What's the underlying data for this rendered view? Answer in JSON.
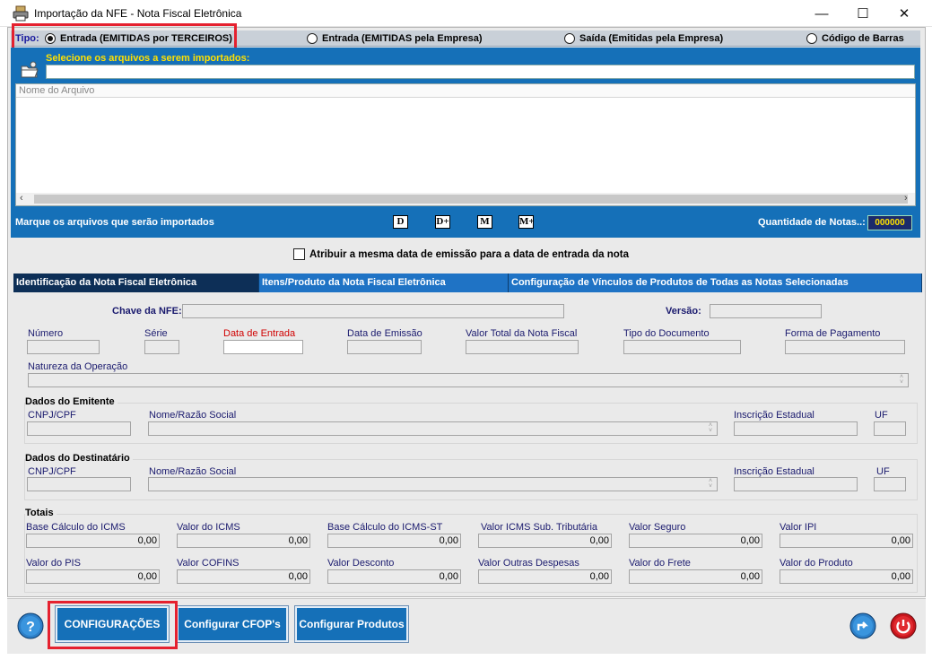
{
  "window": {
    "title": "Importação da NFE - Nota Fiscal Eletrônica",
    "minimize": "—",
    "maximize": "☐",
    "close": "✕"
  },
  "tipo": {
    "label": "Tipo:",
    "options": [
      {
        "label": "Entrada (EMITIDAS por TERCEIROS)",
        "selected": true
      },
      {
        "label": "Entrada (EMITIDAS pela Empresa)",
        "selected": false
      },
      {
        "label": "Saída (Emitidas pela Empresa)",
        "selected": false
      },
      {
        "label": "Código de Barras",
        "selected": false
      }
    ]
  },
  "files": {
    "select_label": "Selecione os arquivos a serem importados:",
    "column_header": "Nome do Arquivo",
    "mark_label": "Marque os arquivos que serão importados",
    "buttons": [
      "D",
      "D+",
      "M",
      "M+"
    ],
    "qty_label": "Quantidade de Notas..:",
    "qty_value": "000000"
  },
  "same_date_label": "Atribuir a mesma data de emissão para a data de entrada da nota",
  "tabs": [
    {
      "label": "Identificação da Nota Fiscal Eletrônica"
    },
    {
      "label": "Itens/Produto da Nota Fiscal Eletrônica"
    },
    {
      "label": "Configuração de Vínculos de Produtos de Todas as Notas Selecionadas"
    }
  ],
  "nfe": {
    "chave_label": "Chave da NFE:",
    "versao_label": "Versão:",
    "numero": "Número",
    "serie": "Série",
    "data_entrada": "Data de Entrada",
    "data_emissao": "Data de Emissão",
    "valor_total": "Valor Total da Nota Fiscal",
    "tipo_documento": "Tipo do Documento",
    "forma_pagamento": "Forma de Pagamento",
    "natureza": "Natureza da Operação"
  },
  "emitente": {
    "title": "Dados do Emitente",
    "cnpj": "CNPJ/CPF",
    "nome": "Nome/Razão Social",
    "ie": "Inscrição Estadual",
    "uf": "UF"
  },
  "destinatario": {
    "title": "Dados do Destinatário",
    "cnpj": "CNPJ/CPF",
    "nome": "Nome/Razão Social",
    "ie": "Inscrição Estadual",
    "uf": "UF"
  },
  "totais": {
    "title": "Totais",
    "row1": [
      {
        "label": "Base Cálculo do ICMS",
        "value": "0,00"
      },
      {
        "label": "Valor do ICMS",
        "value": "0,00"
      },
      {
        "label": "Base Cálculo do ICMS-ST",
        "value": "0,00"
      },
      {
        "label": "Valor ICMS Sub. Tributária",
        "value": "0,00"
      },
      {
        "label": "Valor Seguro",
        "value": "0,00"
      },
      {
        "label": "Valor IPI",
        "value": "0,00"
      }
    ],
    "row2": [
      {
        "label": "Valor do PIS",
        "value": "0,00"
      },
      {
        "label": "Valor COFINS",
        "value": "0,00"
      },
      {
        "label": "Valor Desconto",
        "value": "0,00"
      },
      {
        "label": "Valor Outras Despesas",
        "value": "0,00"
      },
      {
        "label": "Valor do Frete",
        "value": "0,00"
      },
      {
        "label": "Valor do Produto",
        "value": "0,00"
      }
    ]
  },
  "footer": {
    "configuracoes": "CONFIGURAÇÕES",
    "cfop": "Configurar CFOP's",
    "produtos": "Configurar Produtos"
  },
  "colors": {
    "panel_blue": "#1570b8",
    "tab_active": "#0d2f57",
    "highlight_red": "#e5212f",
    "label_red": "#d00000"
  }
}
